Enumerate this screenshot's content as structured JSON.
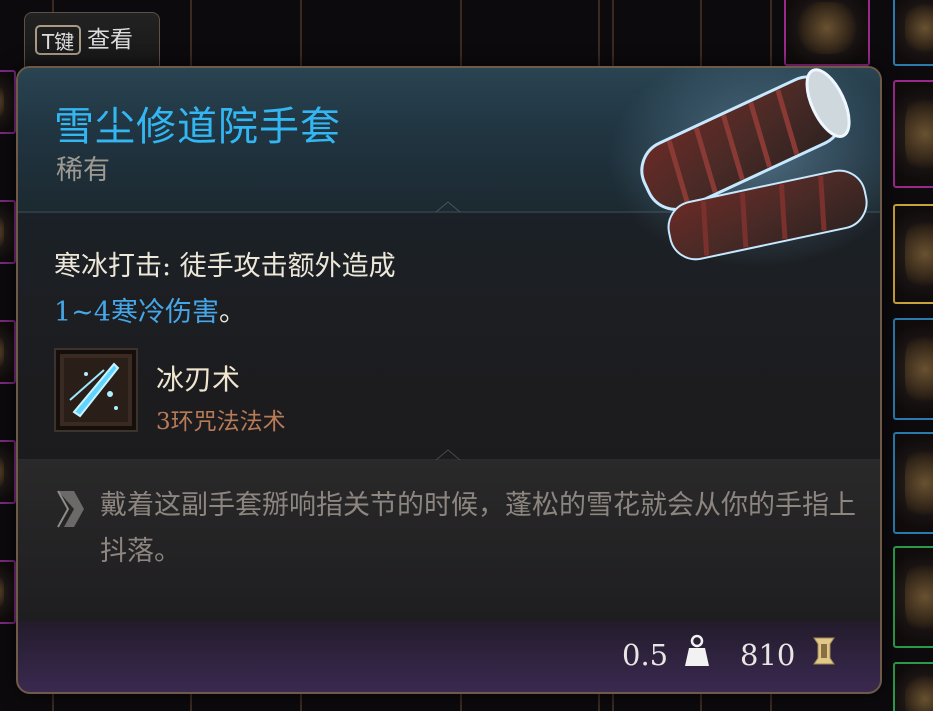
{
  "hint": {
    "key": "T键",
    "action": "查看"
  },
  "item": {
    "name": "雪尘修道院手套",
    "rarity": "稀有",
    "effect_name": "寒冰打击: 徒手攻击额外造成",
    "effect_damage": "1~4寒冷伤害",
    "effect_suffix": "。",
    "spell_name": "冰刃术",
    "spell_level": "3环咒法法术",
    "flavor": "戴着这副手套掰响指关节的时候，蓬松的雪花就会从你的手指上抖落。",
    "weight": "0.5",
    "price": "810"
  },
  "colors": {
    "title": "#33b7f2",
    "damage": "#46a7e8",
    "spell_level": "#b87b58"
  },
  "icons": [
    "gauntlets-art",
    "ice-knife-spell-icon",
    "quill-icon",
    "weight-icon",
    "gold-coin-icon"
  ]
}
